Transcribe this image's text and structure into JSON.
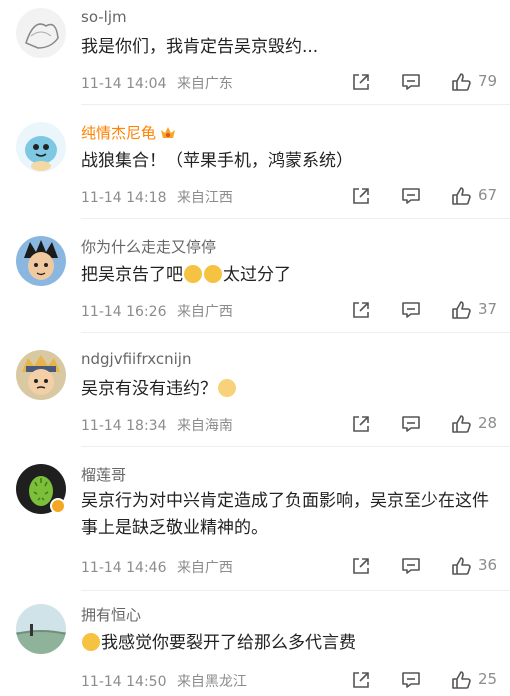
{
  "comments": [
    {
      "username": "so-ljm",
      "text": "我是你们，我肯定告吴京毁约...",
      "timestamp": "11-14 14:04",
      "location": "来自广东",
      "likes": "79"
    },
    {
      "username": "纯情杰尼龟",
      "text": "战狼集合！（苹果手机，鸿蒙系统）",
      "timestamp": "11-14 14:18",
      "location": "来自江西",
      "likes": "67"
    },
    {
      "username": "你为什么走走又停停",
      "text_before": "把吴京告了吧",
      "text_after": "太过分了",
      "timestamp": "11-14 16:26",
      "location": "来自广西",
      "likes": "37"
    },
    {
      "username": "ndgjvfiifrxcnijn",
      "text": "吴京有没有违约？",
      "timestamp": "11-14 18:34",
      "location": "来自海南",
      "likes": "28"
    },
    {
      "username": "榴莲哥",
      "text": "吴京行为对中兴肯定造成了负面影响，吴京至少在这件事上是缺乏敬业精神的。",
      "timestamp": "11-14 14:46",
      "location": "来自广西",
      "likes": "36"
    },
    {
      "username": "拥有恒心",
      "text": "我感觉你要裂开了给那么多代言费",
      "timestamp": "11-14 14:50",
      "location": "来自黑龙江",
      "likes": "25"
    }
  ],
  "colors": {
    "vip_name": "#ff8200",
    "meta": "#8c8c8c",
    "text": "#222222"
  },
  "icons": [
    "share-icon",
    "comment-icon",
    "like-icon",
    "vip-badge-icon",
    "verified-badge-icon",
    "emoji-icon"
  ]
}
